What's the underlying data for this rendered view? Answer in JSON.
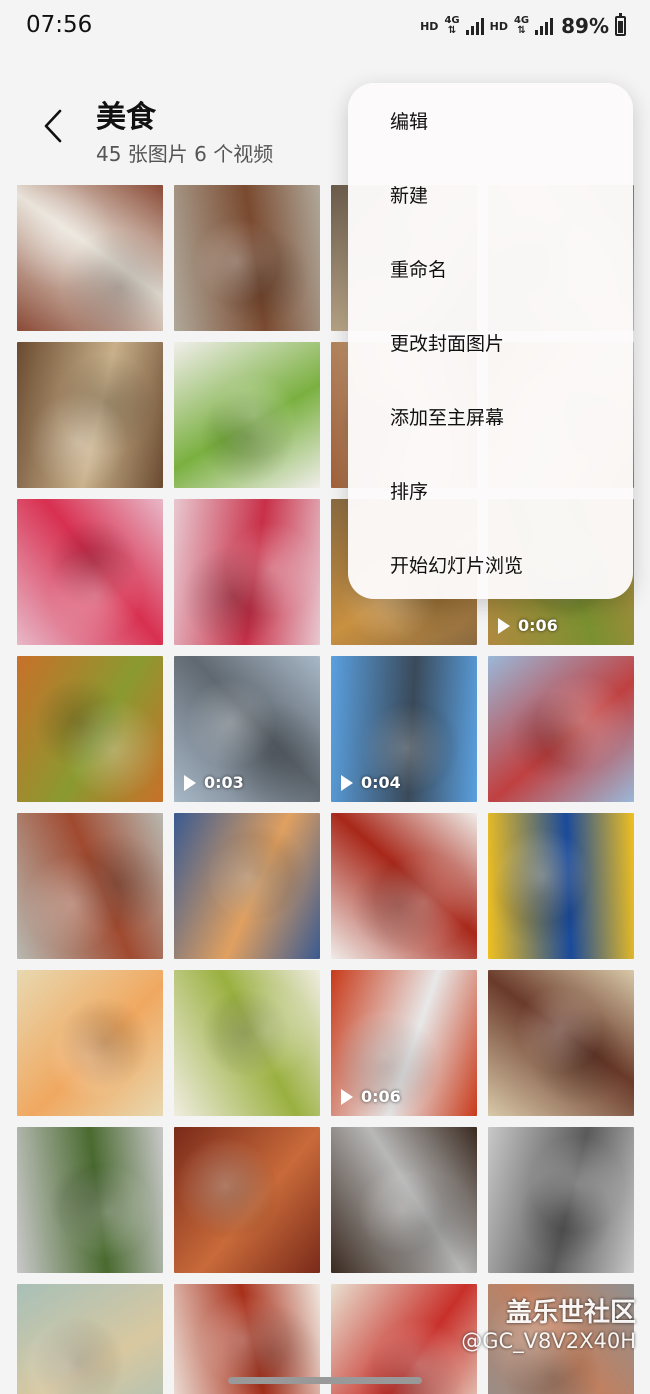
{
  "status_bar": {
    "time": "07:56",
    "hd1": "HD",
    "net1": "4G",
    "hd2": "HD",
    "net2": "4G",
    "battery_pct": "89%"
  },
  "header": {
    "back_icon": "chevron-left-icon",
    "title": "美食",
    "subtitle": "45 张图片 6 个视频"
  },
  "menu": {
    "items": [
      "编辑",
      "新建",
      "重命名",
      "更改封面图片",
      "添加至主屏幕",
      "排序",
      "开始幻灯片浏览"
    ]
  },
  "grid": {
    "thumbnails": [
      {
        "color_a": "#8a4a36",
        "color_b": "#e8e2d8",
        "video": ""
      },
      {
        "color_a": "#b0a89a",
        "color_b": "#7a4a30",
        "video": ""
      },
      {
        "color_a": "#6a5a4a",
        "color_b": "#c4b090",
        "video": ""
      },
      {
        "color_a": "#8a8070",
        "color_b": "#d6c8a8",
        "video": ""
      },
      {
        "color_a": "#6a4a30",
        "color_b": "#c8b08a",
        "video": ""
      },
      {
        "color_a": "#f0eeea",
        "color_b": "#7ab040",
        "video": ""
      },
      {
        "color_a": "#a0603a",
        "color_b": "#d8c098",
        "video": ""
      },
      {
        "color_a": "#b07a40",
        "color_b": "#e0d0b0",
        "video": ""
      },
      {
        "color_a": "#e8b8c8",
        "color_b": "#d83050",
        "video": ""
      },
      {
        "color_a": "#e8c8d0",
        "color_b": "#c83048",
        "video": ""
      },
      {
        "color_a": "#8a6a40",
        "color_b": "#c89040",
        "video": ""
      },
      {
        "color_a": "#b08a40",
        "color_b": "#7a9030",
        "video": "0:06"
      },
      {
        "color_a": "#c8702a",
        "color_b": "#8a9a30",
        "video": ""
      },
      {
        "color_a": "#a8b8c8",
        "color_b": "#606870",
        "video": "0:03"
      },
      {
        "color_a": "#5aa0e0",
        "color_b": "#3a4a5a",
        "video": "0:04"
      },
      {
        "color_a": "#9ab8d8",
        "color_b": "#c04040",
        "video": ""
      },
      {
        "color_a": "#b8b8b0",
        "color_b": "#a04a30",
        "video": ""
      },
      {
        "color_a": "#3a5a90",
        "color_b": "#e0a060",
        "video": ""
      },
      {
        "color_a": "#f0ece8",
        "color_b": "#a8281a",
        "video": ""
      },
      {
        "color_a": "#f0c020",
        "color_b": "#1a4a9a",
        "video": ""
      },
      {
        "color_a": "#e8d8b0",
        "color_b": "#f0a860",
        "video": ""
      },
      {
        "color_a": "#f0ede0",
        "color_b": "#9ab040",
        "video": ""
      },
      {
        "color_a": "#c83a1a",
        "color_b": "#e8e8e8",
        "video": "0:06"
      },
      {
        "color_a": "#d8c8a8",
        "color_b": "#6a3a2a",
        "video": ""
      },
      {
        "color_a": "#c8c8c8",
        "color_b": "#4a6a30",
        "video": ""
      },
      {
        "color_a": "#7a2a1a",
        "color_b": "#c86a3a",
        "video": ""
      },
      {
        "color_a": "#3a2a20",
        "color_b": "#b8b8b8",
        "video": ""
      },
      {
        "color_a": "#c8c8c8",
        "color_b": "#5a5a5a",
        "video": ""
      },
      {
        "color_a": "#a8c0b8",
        "color_b": "#d8c8a0",
        "video": ""
      },
      {
        "color_a": "#f0e8e0",
        "color_b": "#a8301a",
        "video": ""
      },
      {
        "color_a": "#e8e0d0",
        "color_b": "#c8302a",
        "video": ""
      },
      {
        "color_a": "#909090",
        "color_b": "#c08060",
        "video": ""
      }
    ]
  },
  "watermark": {
    "brand": "盖乐世社区",
    "user": "@GC_V8V2X40H"
  }
}
